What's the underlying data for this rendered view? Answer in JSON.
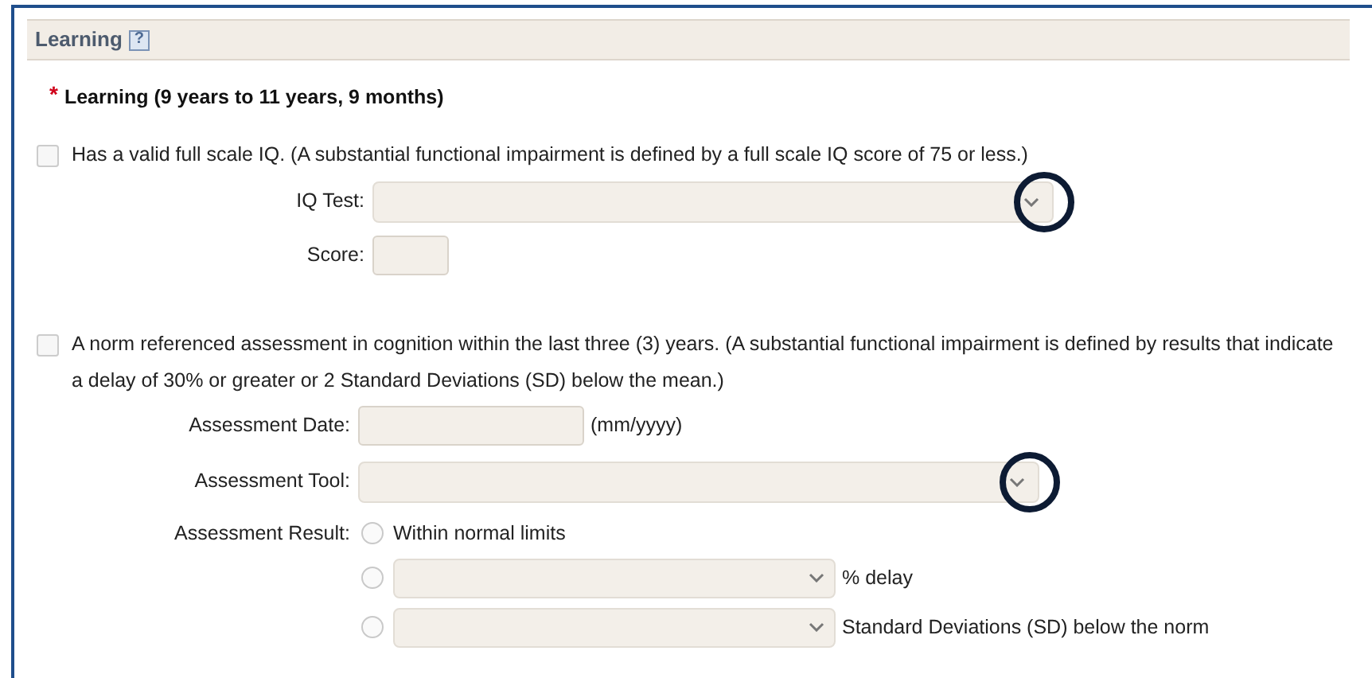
{
  "section": {
    "title": "Learning",
    "help": "?"
  },
  "requirement": {
    "marker": "*",
    "title": "Learning (9 years to 11 years, 9 months)"
  },
  "criteria": [
    {
      "checked": false,
      "label": "Has a valid full scale IQ. (A substantial functional impairment is defined by a full scale IQ score of 75 or less.)",
      "fields": [
        {
          "kind": "select",
          "label": "IQ Test:",
          "highlighted": true
        },
        {
          "kind": "text",
          "label": "Score:"
        }
      ]
    },
    {
      "checked": false,
      "label": "A norm referenced assessment in cognition within the last three (3) years. (A substantial functional impairment is defined by results that indicate a delay of 30% or greater or 2 Standard Deviations (SD) below the mean.)",
      "fields": [
        {
          "kind": "date",
          "label": "Assessment Date:",
          "hint": "(mm/yyyy)"
        },
        {
          "kind": "select",
          "label": "Assessment Tool:",
          "highlighted": true
        },
        {
          "kind": "radios",
          "label": "Assessment Result:",
          "options": [
            {
              "kind": "plain",
              "label": "Within normal limits",
              "selected": false
            },
            {
              "kind": "select",
              "label": "% delay",
              "selected": false
            },
            {
              "kind": "select",
              "label": "Standard Deviations (SD) below the norm",
              "selected": false
            }
          ]
        }
      ]
    }
  ]
}
